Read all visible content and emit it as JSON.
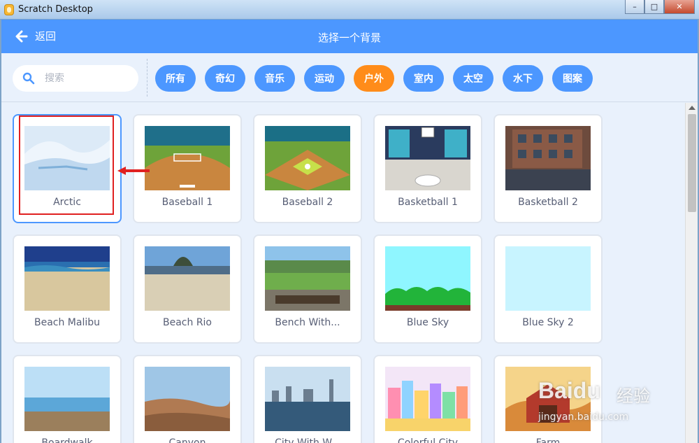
{
  "window": {
    "title": "Scratch Desktop",
    "controls": {
      "minimize": "–",
      "maximize": "□",
      "close": "✕"
    }
  },
  "header": {
    "back_label": "返回",
    "title": "选择一个背景"
  },
  "search": {
    "placeholder": "搜索",
    "value": ""
  },
  "tags": [
    {
      "label": "所有",
      "active": false
    },
    {
      "label": "奇幻",
      "active": false
    },
    {
      "label": "音乐",
      "active": false
    },
    {
      "label": "运动",
      "active": false
    },
    {
      "label": "户外",
      "active": true
    },
    {
      "label": "室内",
      "active": false
    },
    {
      "label": "太空",
      "active": false
    },
    {
      "label": "水下",
      "active": false
    },
    {
      "label": "图案",
      "active": false
    }
  ],
  "backdrops": [
    {
      "label": "Arctic",
      "selected": true
    },
    {
      "label": "Baseball 1"
    },
    {
      "label": "Baseball 2"
    },
    {
      "label": "Basketball 1"
    },
    {
      "label": "Basketball 2"
    },
    {
      "label": "Beach Malibu"
    },
    {
      "label": "Beach Rio"
    },
    {
      "label": "Bench With..."
    },
    {
      "label": "Blue Sky"
    },
    {
      "label": "Blue Sky 2"
    },
    {
      "label": "Boardwalk"
    },
    {
      "label": "Canyon"
    },
    {
      "label": "City With W..."
    },
    {
      "label": "Colorful City"
    },
    {
      "label": "Farm"
    }
  ],
  "colors": {
    "primary": "#4c97ff",
    "active_tag": "#ff8c1a",
    "highlight": "#e02020"
  },
  "watermark": {
    "brand": "Baidu",
    "cn": "经验",
    "url": "jingyan.baidu.com"
  }
}
